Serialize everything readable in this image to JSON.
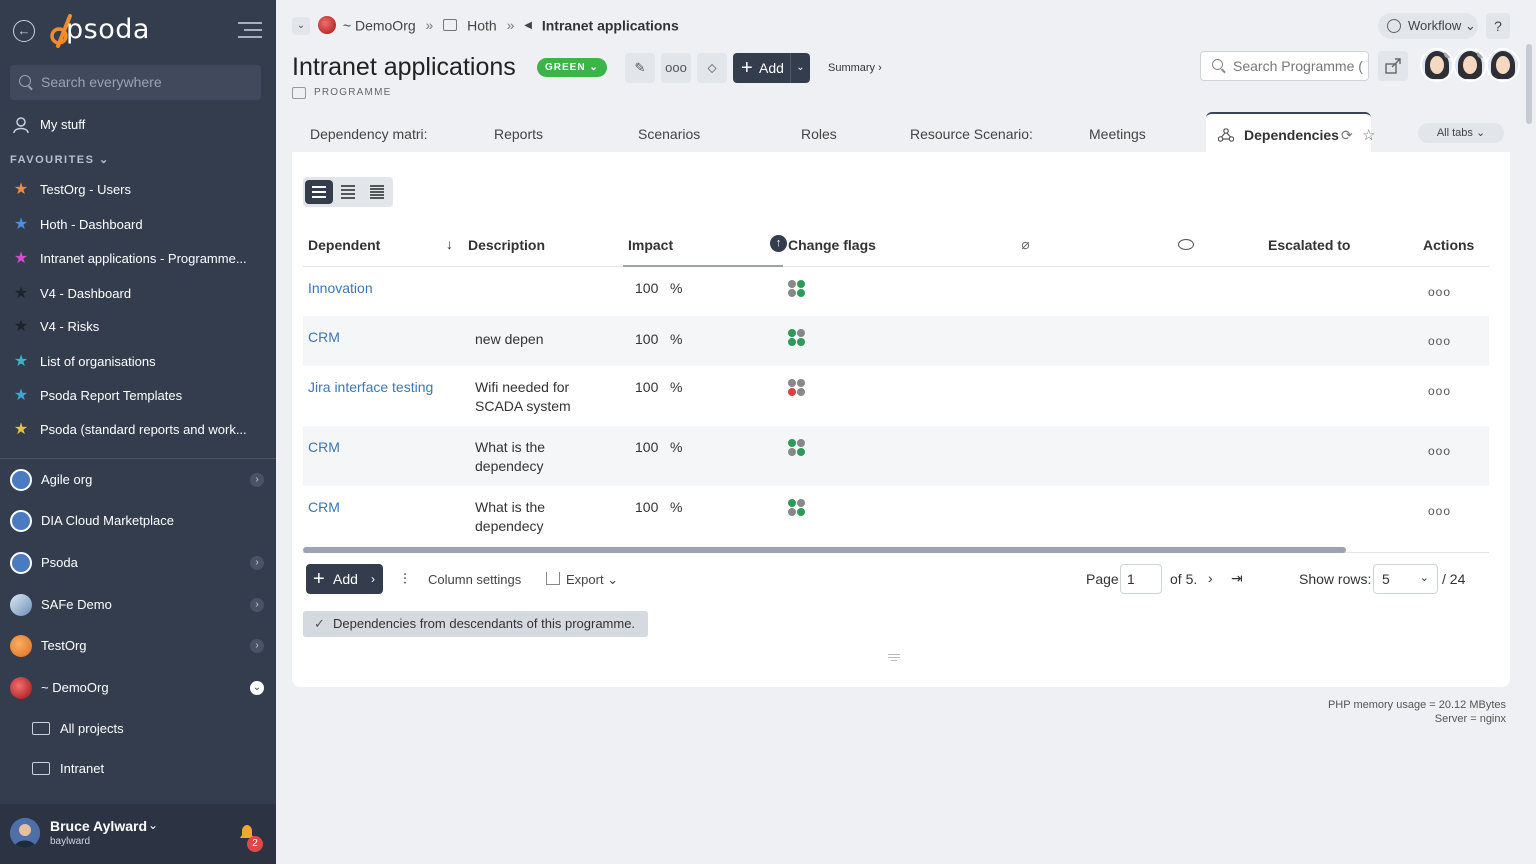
{
  "sidebar": {
    "logo": "psoda",
    "search_placeholder": "Search everywhere",
    "my_stuff": "My stuff",
    "favourites_header": "FAVOURITES",
    "favourites": [
      {
        "label": "TestOrg - Users",
        "color": "#f08a3c"
      },
      {
        "label": "Hoth - Dashboard",
        "color": "#4a8fe0"
      },
      {
        "label": "Intranet applications - Programme...",
        "color": "#d64bd0"
      },
      {
        "label": "V4 - Dashboard",
        "color": "#2a2f38"
      },
      {
        "label": "V4 - Risks",
        "color": "#2a2f38"
      },
      {
        "label": "List of organisations",
        "color": "#3bb5c9"
      },
      {
        "label": "Psoda Report Templates",
        "color": "#3ba6d9"
      },
      {
        "label": "Psoda (standard reports and work...",
        "color": "#e8c23a"
      }
    ],
    "orgs": [
      {
        "label": "Agile org",
        "expandable": true
      },
      {
        "label": "DIA Cloud Marketplace",
        "expandable": false
      },
      {
        "label": "Psoda",
        "expandable": true
      },
      {
        "label": "SAFe Demo",
        "expandable": true
      },
      {
        "label": "TestOrg",
        "expandable": true
      },
      {
        "label": "~ DemoOrg",
        "expandable": true,
        "open": true
      }
    ],
    "sub_items": [
      "All projects",
      "Intranet"
    ],
    "user": {
      "name": "Bruce Aylward",
      "login": "baylward",
      "notifications": "2"
    }
  },
  "breadcrumb": {
    "org": "~ DemoOrg",
    "portfolio": "Hoth",
    "current": "Intranet applications"
  },
  "header": {
    "workflow_label": "Workflow",
    "help_label": "?",
    "title": "Intranet applications",
    "status": "GREEN",
    "type_label": "PROGRAMME",
    "add_label": "Add",
    "summary_label": "Summary ›",
    "search_placeholder": "Search Programme (",
    "status_color": "#3cb44a"
  },
  "tabs": {
    "items": [
      "Dependency matri:",
      "Reports",
      "Scenarios",
      "Roles",
      "Resource Scenario:",
      "Meetings"
    ],
    "active": "Dependencies",
    "all_tabs_label": "All tabs"
  },
  "table": {
    "columns": [
      "Dependent",
      "Description",
      "Impact",
      "Change flags",
      "Escalated to",
      "Actions"
    ],
    "rows": [
      {
        "dependent": "Innovation",
        "desc1": "",
        "desc2": "",
        "impact": "100",
        "unit": "%",
        "flags": [
          "#888",
          "#2e9a5a",
          "#888",
          "#2e9a5a"
        ]
      },
      {
        "dependent": "CRM",
        "desc1": "new depen",
        "desc2": "",
        "impact": "100",
        "unit": "%",
        "flags": [
          "#2e9a5a",
          "#888",
          "#2e9a5a",
          "#2e9a5a"
        ]
      },
      {
        "dependent": "Jira interface testing",
        "desc1": "Wifi needed for",
        "desc2": "SCADA system",
        "impact": "100",
        "unit": "%",
        "flags": [
          "#888",
          "#888",
          "#d94040",
          "#888"
        ]
      },
      {
        "dependent": "CRM",
        "desc1": "What is the",
        "desc2": "dependecy",
        "impact": "100",
        "unit": "%",
        "flags": [
          "#2e9a5a",
          "#888",
          "#888",
          "#2e9a5a"
        ]
      },
      {
        "dependent": "CRM",
        "desc1": "What is the",
        "desc2": "dependecy",
        "impact": "100",
        "unit": "%",
        "flags": [
          "#2e9a5a",
          "#888",
          "#888",
          "#2e9a5a"
        ]
      }
    ]
  },
  "footer": {
    "add_label": "Add",
    "column_settings_label": "Column settings",
    "export_label": "Export",
    "page_label": "Page",
    "page_value": "1",
    "of_label": "of 5.",
    "show_rows_label": "Show rows:",
    "rows_value": "5",
    "total_label": "/ 24",
    "filter_chip": "Dependencies from descendants of this programme."
  },
  "server": {
    "memory": "PHP memory usage = 20.12 MBytes",
    "server": "Server = nginx"
  }
}
